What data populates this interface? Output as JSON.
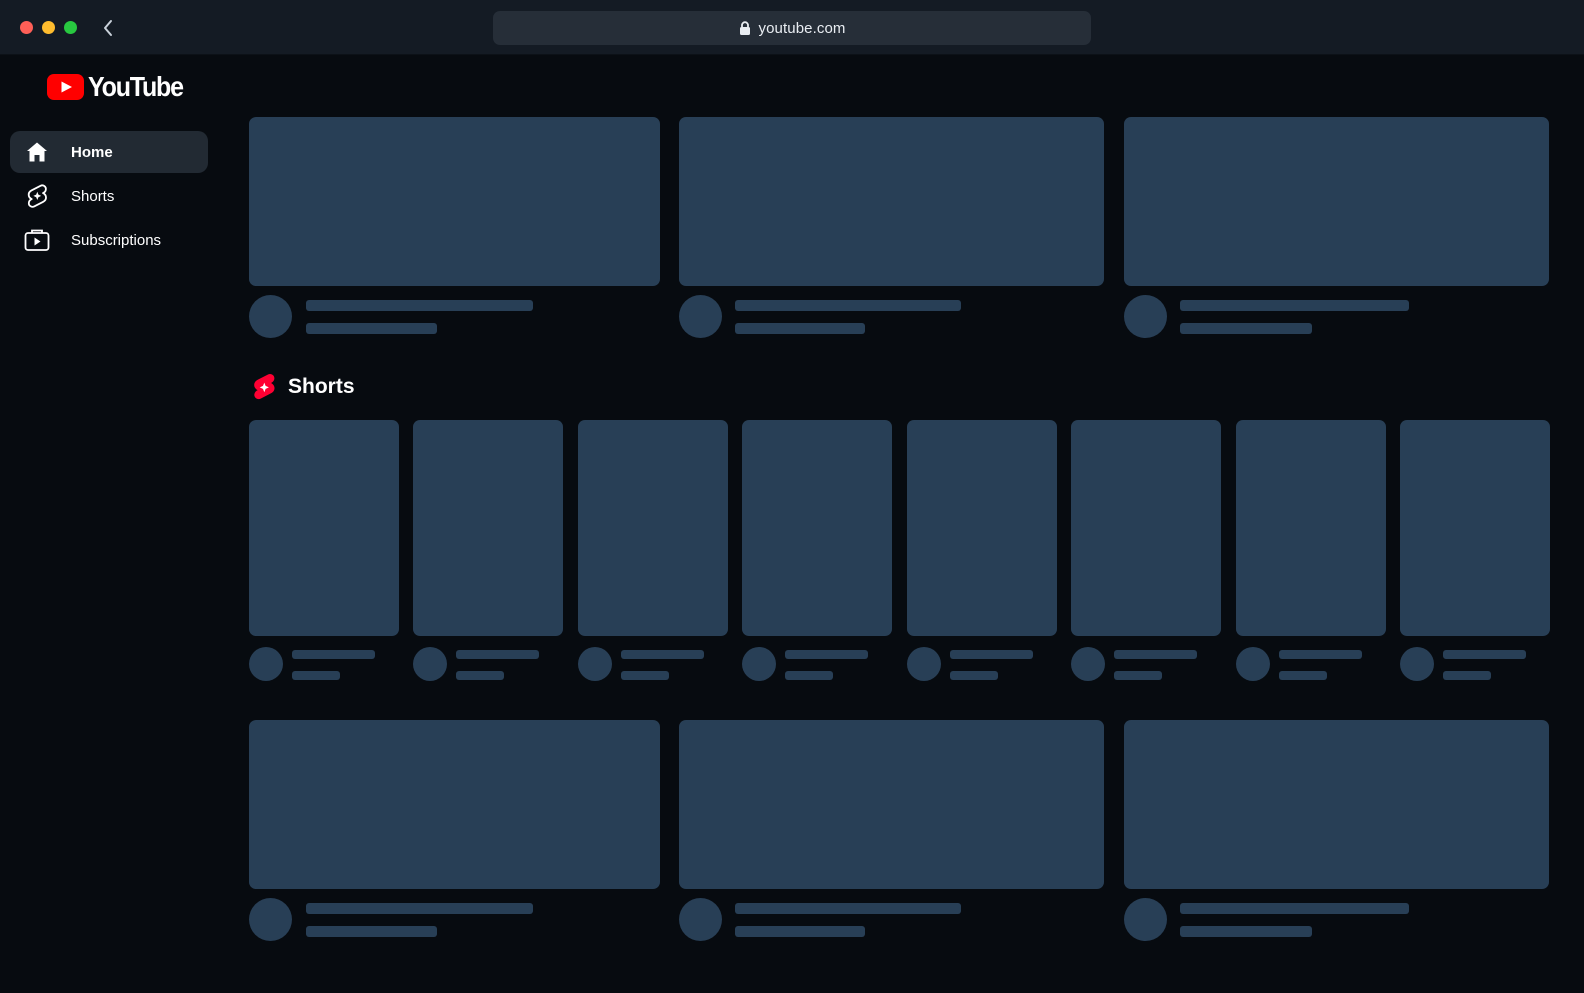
{
  "browser": {
    "url": "youtube.com",
    "icons": {
      "back": "chevron-left-icon",
      "lock": "lock-icon"
    }
  },
  "brand": {
    "logo_text": "YouTube",
    "logo_color": "#ff0000"
  },
  "sidebar": {
    "items": [
      {
        "label": "Home",
        "icon": "home-icon",
        "active": true
      },
      {
        "label": "Shorts",
        "icon": "shorts-icon",
        "active": false
      },
      {
        "label": "Subscriptions",
        "icon": "subscriptions-icon",
        "active": false
      }
    ]
  },
  "main": {
    "shorts_section": {
      "title": "Shorts",
      "icon": "shorts-logo-icon",
      "accent": "#ff0033"
    }
  },
  "colors": {
    "background": "#070b10",
    "titlebar": "#141b24",
    "skeleton": "#283f56",
    "active_nav": "#222a33"
  }
}
